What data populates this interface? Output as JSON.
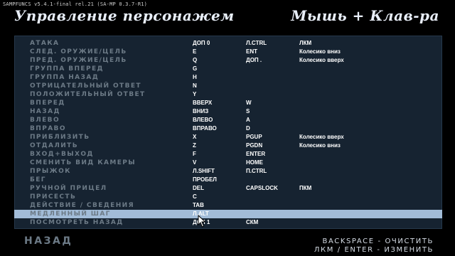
{
  "overlay_text": "SAMPFUNCS v5.4.1-final rel.21 (SA-MP 0.3.7-R1)",
  "header": {
    "left_title": "Управление персонажем",
    "right_title": "Мышь + Клав-ра"
  },
  "rows": [
    {
      "action": "АТАКА",
      "key1": "ДОП 0",
      "key2": "Л.CTRL",
      "key3": "ЛКМ"
    },
    {
      "action": "СЛЕД. ОРУЖИЕ/ЦЕЛЬ",
      "key1": "E",
      "key2": "ENT",
      "key3": "Колесико вниз"
    },
    {
      "action": "ПРЕД. ОРУЖИЕ/ЦЕЛЬ",
      "key1": "Q",
      "key2": "ДОП .",
      "key3": "Колесико вверх"
    },
    {
      "action": "ГРУППА ВПЕРЕД",
      "key1": "G",
      "key2": "",
      "key3": ""
    },
    {
      "action": "ГРУППА НАЗАД",
      "key1": "H",
      "key2": "",
      "key3": ""
    },
    {
      "action": "ОТРИЦАТЕЛЬНЫЙ ОТВЕТ",
      "key1": "N",
      "key2": "",
      "key3": ""
    },
    {
      "action": "ПОЛОЖИТЕЛЬНЫЙ ОТВЕТ",
      "key1": "Y",
      "key2": "",
      "key3": ""
    },
    {
      "action": "ВПЕРЕД",
      "key1": "ВВЕРХ",
      "key2": "W",
      "key3": ""
    },
    {
      "action": "НАЗАД",
      "key1": "ВНИЗ",
      "key2": "S",
      "key3": ""
    },
    {
      "action": "ВЛЕВО",
      "key1": "ВЛЕВО",
      "key2": "A",
      "key3": ""
    },
    {
      "action": "ВПРАВО",
      "key1": "ВПРАВО",
      "key2": "D",
      "key3": ""
    },
    {
      "action": "ПРИБЛИЗИТЬ",
      "key1": "X",
      "key2": "PGUP",
      "key3": "Колесико вверх"
    },
    {
      "action": "ОТДАЛИТЬ",
      "key1": "Z",
      "key2": "PGDN",
      "key3": "Колесико вниз"
    },
    {
      "action": "ВХОД+ВЫХОД",
      "key1": "F",
      "key2": "ENTER",
      "key3": ""
    },
    {
      "action": "СМЕНИТЬ ВИД КАМЕРЫ",
      "key1": "V",
      "key2": "HOME",
      "key3": ""
    },
    {
      "action": "ПРЫЖОК",
      "key1": "Л.SHIFT",
      "key2": "П.CTRL",
      "key3": ""
    },
    {
      "action": "БЕГ",
      "key1": "ПРОБЕЛ",
      "key2": "",
      "key3": ""
    },
    {
      "action": "РУЧНОЙ ПРИЦЕЛ",
      "key1": "DEL",
      "key2": "CAPSLOCK",
      "key3": "ПКМ"
    },
    {
      "action": "ПРИСЕСТЬ",
      "key1": "C",
      "key2": "",
      "key3": ""
    },
    {
      "action": "ДЕЙСТВИЕ / СВЕДЕНИЯ",
      "key1": "TAB",
      "key2": "",
      "key3": ""
    },
    {
      "action": "МЕДЛЕННЫЙ ШАГ",
      "key1": "Л.ALT",
      "key2": "",
      "key3": ""
    },
    {
      "action": "ПОСМОТРЕТЬ НАЗАД",
      "key1": "ДОП 1",
      "key2": "СКМ",
      "key3": ""
    }
  ],
  "selected_row": 20,
  "footer": {
    "back_label": "НАЗАД",
    "hint_clear": "BACKSPACE - ОЧИСТИТЬ",
    "hint_change": "ЛКМ / ENTER - ИЗМЕНИТЬ"
  },
  "colors": {
    "panel": "#162331",
    "highlight": "#a2bcd8",
    "action_text": "#6c7a86",
    "key_text": "#ffffff"
  },
  "icons": {
    "cursor": "mouse-pointer-icon"
  }
}
